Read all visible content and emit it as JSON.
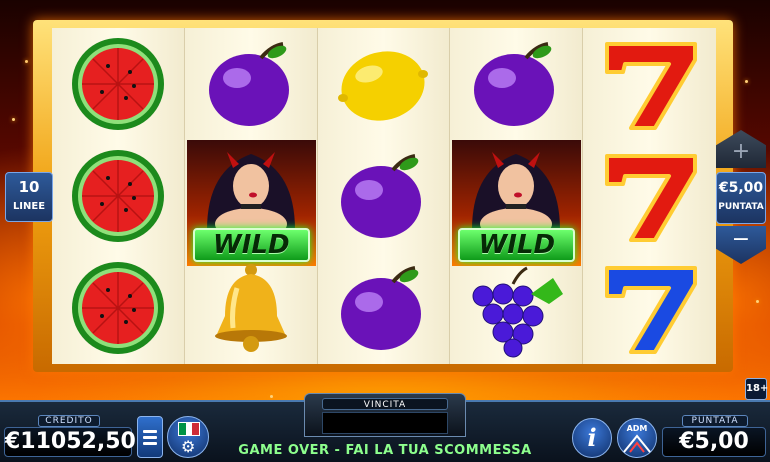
{
  "reels": [
    [
      "watermelon",
      "watermelon",
      "watermelon"
    ],
    [
      "plum",
      "wild",
      "bell"
    ],
    [
      "lemon",
      "plum",
      "plum"
    ],
    [
      "plum",
      "wild",
      "grapes"
    ],
    [
      "seven-red",
      "seven-red",
      "seven-blue"
    ]
  ],
  "wild_label": "WILD",
  "lines": {
    "value": "10",
    "label": "LINEE"
  },
  "bet_control": {
    "plus": "+",
    "value": "€5,00",
    "label": "PUNTATA",
    "minus": "−"
  },
  "age_badge": "18+",
  "credit": {
    "label": "CREDITO",
    "value": "€11052,50"
  },
  "win": {
    "label": "VINCITA",
    "value": ""
  },
  "status_message": "GAME OVER - FAI LA TUA SCOMMESSA",
  "bet": {
    "label": "PUNTATA",
    "value": "€5,00"
  },
  "info_glyph": "i",
  "adm_logo_text": "ADM",
  "colors": {
    "frame": "#f0a010",
    "reel_bg": "#fffbe8",
    "panel_blue": "#1c3461",
    "status_green": "#8dff8d",
    "flag": [
      "#009246",
      "#ffffff",
      "#ce2b37"
    ]
  }
}
